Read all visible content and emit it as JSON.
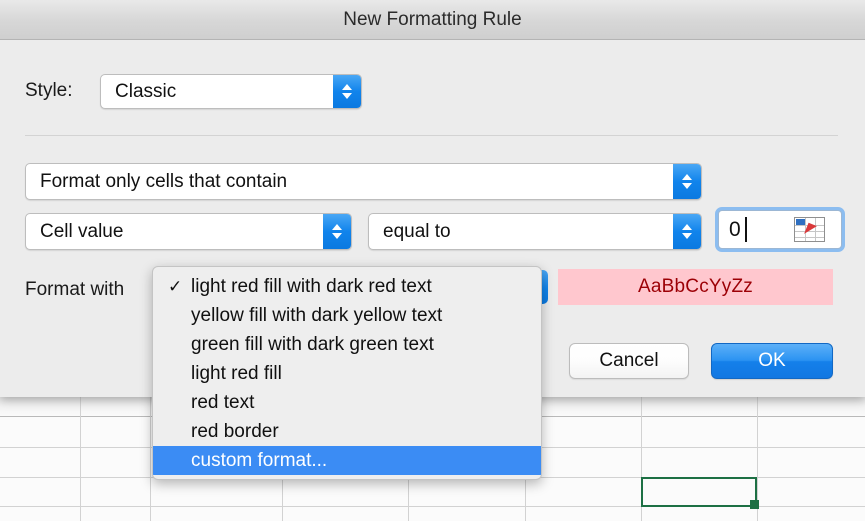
{
  "window": {
    "title": "New Formatting Rule"
  },
  "style_row": {
    "label": "Style:",
    "value": "Classic",
    "stepper_icon": "chevron-up-down-icon"
  },
  "rule_type": {
    "value": "Format only cells that contain",
    "stepper_icon": "chevron-up-down-icon"
  },
  "condition": {
    "subject": "Cell value",
    "operator": "equal to",
    "value": "0",
    "range_picker_icon": "range-selector-icon"
  },
  "format_with": {
    "label": "Format with",
    "selected": "light red fill with dark red text",
    "check_icon": "✓",
    "options": [
      "light red fill with dark red text",
      "yellow fill with dark yellow text",
      "green fill with dark green text",
      "light red fill",
      "red text",
      "red border",
      "custom format..."
    ],
    "highlighted_option": "custom format...",
    "highlight_color": "#3b8cf4"
  },
  "preview": {
    "text": "AaBbCcYyZz",
    "fill_color": "#ffc7ce",
    "text_color": "#9c0006"
  },
  "buttons": {
    "cancel": "Cancel",
    "ok": "OK",
    "ok_accent_color": "#1480ea"
  },
  "background_sheet": {
    "selected_cell_border_color": "#1d7044"
  }
}
